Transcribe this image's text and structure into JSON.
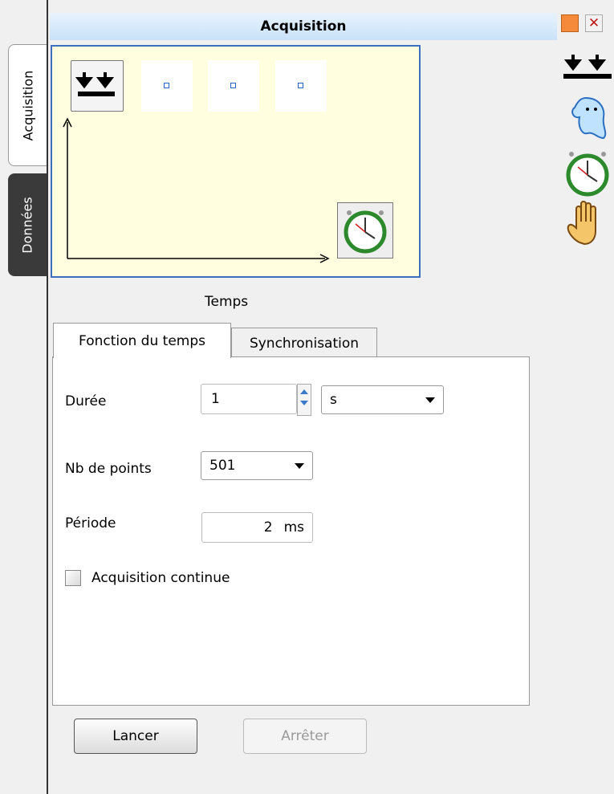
{
  "window": {
    "title": "Acquisition"
  },
  "side_tabs": [
    {
      "label": "Acquisition",
      "active": true
    },
    {
      "label": "Données",
      "active": false
    }
  ],
  "canvas": {
    "axis_label": "Temps"
  },
  "tabs": [
    {
      "label": "Fonction du temps",
      "active": true
    },
    {
      "label": "Synchronisation",
      "active": false
    }
  ],
  "form": {
    "duree": {
      "label": "Durée",
      "value": "1",
      "unit": "s"
    },
    "nb_points": {
      "label": "Nb de points",
      "value": "501"
    },
    "periode": {
      "label": "Période",
      "value": "2",
      "unit": "ms"
    },
    "continue": {
      "label": "Acquisition continue",
      "checked": false
    }
  },
  "buttons": {
    "start": "Lancer",
    "stop": "Arrêter"
  },
  "colors": {
    "canvas_bg": "#ffffe0",
    "canvas_border": "#3c6fbf",
    "title_bg": "#c9e2f8",
    "min_button": "#f58a3a",
    "close_x": "#c01818"
  },
  "icons": [
    "trigger-icon",
    "ghost-icon",
    "stopwatch-icon",
    "hand-icon",
    "stopwatch-icon"
  ]
}
